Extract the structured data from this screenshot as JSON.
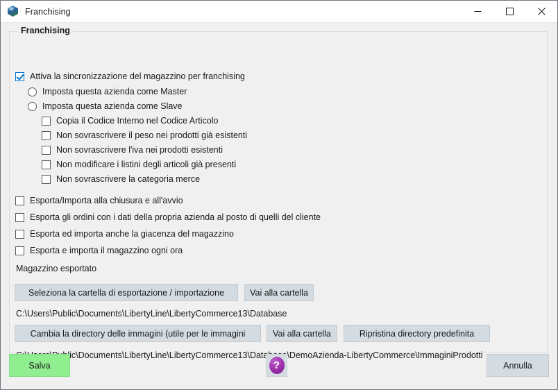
{
  "window": {
    "title": "Franchising",
    "icon": "app-cube-icon",
    "controls": {
      "minimize": "minimize-icon",
      "maximize": "maximize-icon",
      "close": "close-icon"
    }
  },
  "group": {
    "legend": "Franchising",
    "master_checkbox": {
      "label": "Attiva la sincronizzazione del magazzino per franchising",
      "checked": true
    },
    "radios": [
      {
        "label": "Imposta questa azienda come Master",
        "selected": false
      },
      {
        "label": "Imposta questa azienda come Slave",
        "selected": false
      }
    ],
    "sub_checkboxes": [
      {
        "label": "Copia il Codice Interno nel Codice Articolo",
        "checked": false
      },
      {
        "label": "Non sovrascrivere il peso nei prodotti già esistenti",
        "checked": false
      },
      {
        "label": "Non sovrascrivere l'iva nei prodotti esistenti",
        "checked": false
      },
      {
        "label": "Non modificare i listini degli articoli già presenti",
        "checked": false
      },
      {
        "label": "Non sovrascrivere la categoria merce",
        "checked": false
      }
    ],
    "main_checkboxes": [
      {
        "label": "Esporta/Importa alla chiusura e all'avvio",
        "checked": false
      },
      {
        "label": "Esporta gli ordini con i dati della propria azienda al posto di quelli del cliente",
        "checked": false
      },
      {
        "label": "Esporta ed importa anche la giacenza del magazzino",
        "checked": false
      },
      {
        "label": "Esporta e importa il magazzino ogni ora",
        "checked": false
      }
    ],
    "warehouse_label": "Magazzino esportato",
    "export_row": {
      "select_folder_button": "Seleziona la cartella di esportazione / importazione",
      "go_to_folder_button": "Vai alla cartella",
      "path": "C:\\Users\\Public\\Documents\\LibertyLine\\LibertyCommerce13\\Database"
    },
    "images_row": {
      "change_dir_button": "Cambia la directory delle immagini (utile per le immagini",
      "go_to_folder_button": "Vai alla cartella",
      "restore_default_button": "Ripristina directory predefinita",
      "path": "C:\\Users\\Public\\Documents\\LibertyLine\\LibertyCommerce13\\Database\\DemoAzienda-LibertyCommerce\\ImmaginiProdotti"
    }
  },
  "footer": {
    "save_button": "Salva",
    "help_button": "?",
    "cancel_button": "Annulla"
  },
  "colors": {
    "save_green": "#90ee90",
    "button_gray": "#d4dce2",
    "help_purple": "#9b2ea8",
    "checkbox_blue": "#0078d7",
    "window_bg": "#f0f0f0"
  }
}
